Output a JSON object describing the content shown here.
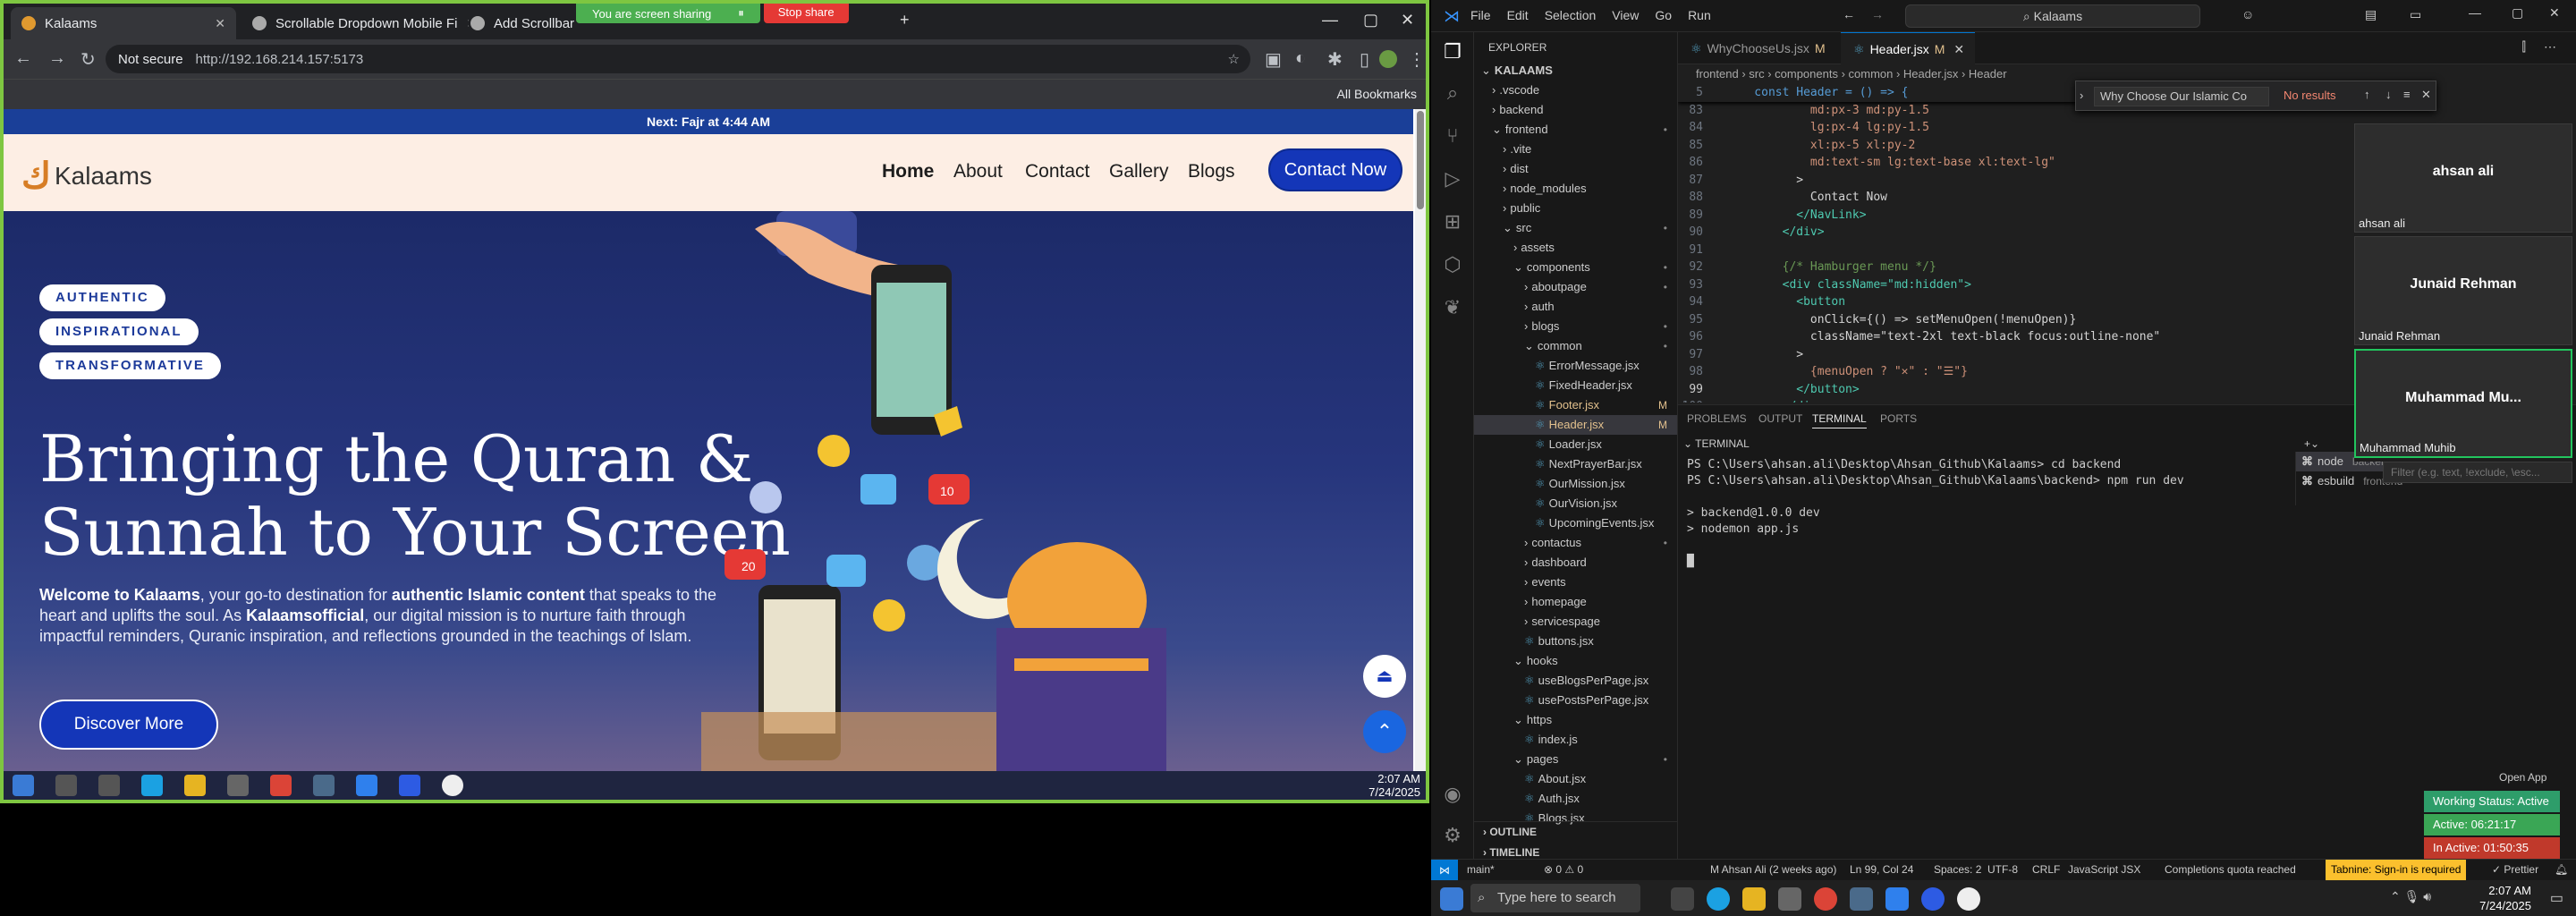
{
  "browser": {
    "tabs": [
      {
        "title": "Kalaams",
        "active": true
      },
      {
        "title": "Scrollable Dropdown Mobile Fi"
      },
      {
        "title": "Add Scrollbar and Fix Navigat"
      }
    ],
    "screen_share_text": "You are screen sharing",
    "stop_share_label": "Stop share",
    "not_secure_label": "Not secure",
    "url": "http://192.168.214.157:5173",
    "all_bookmarks_label": "All Bookmarks",
    "time": "2:07 AM",
    "date": "7/24/2025"
  },
  "site": {
    "prayer_bar": "Next: Fajr at 4:44 AM",
    "logo_text": "Kalaams",
    "nav": [
      "Home",
      "About",
      "Contact",
      "Gallery",
      "Blogs"
    ],
    "contact_button": "Contact Now",
    "badges": [
      "AUTHENTIC",
      "INSPIRATIONAL",
      "TRANSFORMATIVE"
    ],
    "headline_line1": "Bringing the Quran &",
    "headline_line2": "Sunnah to Your Screen",
    "hero_text": {
      "p1": "Welcome to Kalaams",
      "p2": ", your go-to destination for ",
      "p3": "authentic Islamic content",
      "p4": " that speaks to the heart and uplifts the soul. As ",
      "p5": "Kalaamsofficial",
      "p6": ", our digital mission is to nurture faith through impactful reminders, Quranic inspiration, and reflections grounded in the teachings of Islam."
    },
    "discover_button": "Discover More",
    "badge_counts": [
      "20",
      "10"
    ]
  },
  "vscode": {
    "menu": [
      "File",
      "Edit",
      "Selection",
      "View",
      "Go",
      "Run"
    ],
    "search": "Kalaams",
    "explorer_title": "EXPLORER",
    "tree": [
      {
        "t": "KALAAMS",
        "i": 0,
        "k": "root"
      },
      {
        "t": ".vscode",
        "i": 1,
        "k": "dirc"
      },
      {
        "t": "backend",
        "i": 1,
        "k": "dirc"
      },
      {
        "t": "frontend",
        "i": 1,
        "k": "diro",
        "dot": "•"
      },
      {
        "t": ".vite",
        "i": 2,
        "k": "dirc"
      },
      {
        "t": "dist",
        "i": 2,
        "k": "dirc"
      },
      {
        "t": "node_modules",
        "i": 2,
        "k": "dirc"
      },
      {
        "t": "public",
        "i": 2,
        "k": "dirc"
      },
      {
        "t": "src",
        "i": 2,
        "k": "diro",
        "dot": "•"
      },
      {
        "t": "assets",
        "i": 3,
        "k": "dirc"
      },
      {
        "t": "components",
        "i": 3,
        "k": "diro",
        "dot": "•"
      },
      {
        "t": "aboutpage",
        "i": 4,
        "k": "dirc",
        "dot": "•"
      },
      {
        "t": "auth",
        "i": 4,
        "k": "dirc"
      },
      {
        "t": "blogs",
        "i": 4,
        "k": "dirc",
        "dot": "•"
      },
      {
        "t": "common",
        "i": 4,
        "k": "diro",
        "dot": "•"
      },
      {
        "t": "ErrorMessage.jsx",
        "i": 5,
        "k": "file"
      },
      {
        "t": "FixedHeader.jsx",
        "i": 5,
        "k": "file"
      },
      {
        "t": "Footer.jsx",
        "i": 5,
        "k": "file",
        "m": "M"
      },
      {
        "t": "Header.jsx",
        "i": 5,
        "k": "file",
        "m": "M",
        "sel": true
      },
      {
        "t": "Loader.jsx",
        "i": 5,
        "k": "file"
      },
      {
        "t": "NextPrayerBar.jsx",
        "i": 5,
        "k": "file"
      },
      {
        "t": "OurMission.jsx",
        "i": 5,
        "k": "file"
      },
      {
        "t": "OurVision.jsx",
        "i": 5,
        "k": "file"
      },
      {
        "t": "UpcomingEvents.jsx",
        "i": 5,
        "k": "file"
      },
      {
        "t": "contactus",
        "i": 4,
        "k": "dirc",
        "dot": "•"
      },
      {
        "t": "dashboard",
        "i": 4,
        "k": "dirc"
      },
      {
        "t": "events",
        "i": 4,
        "k": "dirc"
      },
      {
        "t": "homepage",
        "i": 4,
        "k": "dirc"
      },
      {
        "t": "servicespage",
        "i": 4,
        "k": "dirc"
      },
      {
        "t": "buttons.jsx",
        "i": 4,
        "k": "file"
      },
      {
        "t": "hooks",
        "i": 3,
        "k": "diro"
      },
      {
        "t": "useBlogsPerPage.jsx",
        "i": 4,
        "k": "file"
      },
      {
        "t": "usePostsPerPage.jsx",
        "i": 4,
        "k": "file"
      },
      {
        "t": "https",
        "i": 3,
        "k": "diro"
      },
      {
        "t": "index.js",
        "i": 4,
        "k": "file"
      },
      {
        "t": "pages",
        "i": 3,
        "k": "diro",
        "dot": "•"
      },
      {
        "t": "About.jsx",
        "i": 4,
        "k": "file"
      },
      {
        "t": "Auth.jsx",
        "i": 4,
        "k": "file"
      },
      {
        "t": "Blogs.jsx",
        "i": 4,
        "k": "file"
      }
    ],
    "outline_label": "OUTLINE",
    "timeline_label": "TIMELINE",
    "tabs": [
      {
        "name": "WhyChooseUs.jsx",
        "mod": "M"
      },
      {
        "name": "Header.jsx",
        "mod": "M",
        "active": true
      }
    ],
    "breadcrumb": "frontend › src › components › common › Header.jsx › Header",
    "find_text": "Why Choose Our Islamic Co",
    "find_result": "No results",
    "code_lines": [
      {
        "n": "5",
        "c": "    const Header = () => {"
      },
      {
        "n": "83",
        "c": "            md:px-3 md:py-1.5"
      },
      {
        "n": "84",
        "c": "            lg:px-4 lg:py-1.5"
      },
      {
        "n": "85",
        "c": "            xl:px-5 xl:py-2"
      },
      {
        "n": "86",
        "c": "            md:text-sm lg:text-base xl:text-lg\""
      },
      {
        "n": "87",
        "c": "          >"
      },
      {
        "n": "88",
        "c": "            Contact Now"
      },
      {
        "n": "89",
        "c": "          </NavLink>"
      },
      {
        "n": "90",
        "c": "        </div>"
      },
      {
        "n": "91",
        "c": ""
      },
      {
        "n": "92",
        "c": "        {/* Hamburger menu */}"
      },
      {
        "n": "93",
        "c": "        <div className=\"md:hidden\">"
      },
      {
        "n": "94",
        "c": "          <button"
      },
      {
        "n": "95",
        "c": "            onClick={() => setMenuOpen(!menuOpen)}"
      },
      {
        "n": "96",
        "c": "            className=\"text-2xl text-black focus:outline-none\""
      },
      {
        "n": "97",
        "c": "          >"
      },
      {
        "n": "98",
        "c": "            {menuOpen ? \"✕\" : \"☰\"}"
      },
      {
        "n": "99",
        "c": "          </button>"
      },
      {
        "n": "100",
        "c": "        </div>"
      }
    ],
    "panel_tabs": [
      "PROBLEMS",
      "OUTPUT",
      "TERMINAL",
      "PORTS"
    ],
    "terminal_label": "TERMINAL",
    "terminal_lines": [
      "PS C:\\Users\\ahsan.ali\\Desktop\\Ahsan_Github\\Kalaams> cd backend",
      "PS C:\\Users\\ahsan.ali\\Desktop\\Ahsan_Github\\Kalaams\\backend> npm run dev",
      "",
      "> backend@1.0.0 dev",
      "> nodemon app.js",
      "",
      "█"
    ],
    "terminal_list": [
      {
        "name": "node",
        "sub": "backend",
        "on": true
      },
      {
        "name": "esbuild",
        "sub": "frontend"
      }
    ],
    "filter_placeholder": "Filter (e.g. text, !exclude, \\esc...",
    "participants": [
      {
        "name": "ahsan ali",
        "label": "ahsan ali"
      },
      {
        "name": "Junaid Rehman",
        "label": "Junaid Rehman"
      },
      {
        "name": "Muhammad  Mu...",
        "label": "Muhammad Muhib",
        "speaking": true
      }
    ],
    "status": {
      "branch": "main*",
      "errors": "⊗ 0 ⚠ 0",
      "author": "M Ahsan Ali (2 weeks ago)",
      "pos": "Ln 99, Col 24",
      "spaces": "Spaces: 2",
      "enc": "UTF-8",
      "eol": "CRLF",
      "lang": "JavaScript JSX",
      "quota": "Completions quota reached",
      "tabnine": "Tabnine: Sign-in is required",
      "prettier": "✓ Prettier"
    },
    "open_app_label": "Open App",
    "work_status": [
      {
        "t": "Working Status: Active",
        "c": "#2e9d6a"
      },
      {
        "t": "Active: 06:21:17",
        "c": "#3aa655"
      },
      {
        "t": "In Active: 01:50:35",
        "c": "#c0392b"
      }
    ]
  },
  "taskbar": {
    "search_placeholder": "Type here to search",
    "time": "2:07 AM",
    "date": "7/24/2025"
  }
}
